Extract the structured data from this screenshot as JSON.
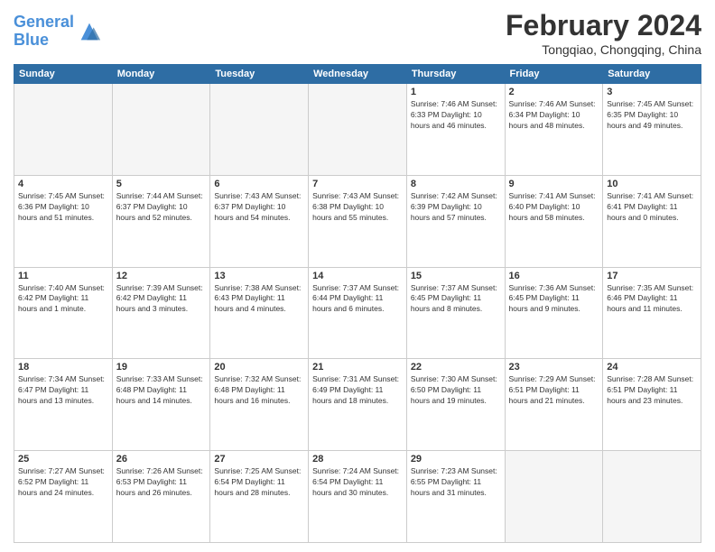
{
  "logo": {
    "line1": "General",
    "line2": "Blue"
  },
  "title": "February 2024",
  "subtitle": "Tongqiao, Chongqing, China",
  "headers": [
    "Sunday",
    "Monday",
    "Tuesday",
    "Wednesday",
    "Thursday",
    "Friday",
    "Saturday"
  ],
  "weeks": [
    [
      {
        "day": "",
        "info": ""
      },
      {
        "day": "",
        "info": ""
      },
      {
        "day": "",
        "info": ""
      },
      {
        "day": "",
        "info": ""
      },
      {
        "day": "1",
        "info": "Sunrise: 7:46 AM\nSunset: 6:33 PM\nDaylight: 10 hours\nand 46 minutes."
      },
      {
        "day": "2",
        "info": "Sunrise: 7:46 AM\nSunset: 6:34 PM\nDaylight: 10 hours\nand 48 minutes."
      },
      {
        "day": "3",
        "info": "Sunrise: 7:45 AM\nSunset: 6:35 PM\nDaylight: 10 hours\nand 49 minutes."
      }
    ],
    [
      {
        "day": "4",
        "info": "Sunrise: 7:45 AM\nSunset: 6:36 PM\nDaylight: 10 hours\nand 51 minutes."
      },
      {
        "day": "5",
        "info": "Sunrise: 7:44 AM\nSunset: 6:37 PM\nDaylight: 10 hours\nand 52 minutes."
      },
      {
        "day": "6",
        "info": "Sunrise: 7:43 AM\nSunset: 6:37 PM\nDaylight: 10 hours\nand 54 minutes."
      },
      {
        "day": "7",
        "info": "Sunrise: 7:43 AM\nSunset: 6:38 PM\nDaylight: 10 hours\nand 55 minutes."
      },
      {
        "day": "8",
        "info": "Sunrise: 7:42 AM\nSunset: 6:39 PM\nDaylight: 10 hours\nand 57 minutes."
      },
      {
        "day": "9",
        "info": "Sunrise: 7:41 AM\nSunset: 6:40 PM\nDaylight: 10 hours\nand 58 minutes."
      },
      {
        "day": "10",
        "info": "Sunrise: 7:41 AM\nSunset: 6:41 PM\nDaylight: 11 hours\nand 0 minutes."
      }
    ],
    [
      {
        "day": "11",
        "info": "Sunrise: 7:40 AM\nSunset: 6:42 PM\nDaylight: 11 hours\nand 1 minute."
      },
      {
        "day": "12",
        "info": "Sunrise: 7:39 AM\nSunset: 6:42 PM\nDaylight: 11 hours\nand 3 minutes."
      },
      {
        "day": "13",
        "info": "Sunrise: 7:38 AM\nSunset: 6:43 PM\nDaylight: 11 hours\nand 4 minutes."
      },
      {
        "day": "14",
        "info": "Sunrise: 7:37 AM\nSunset: 6:44 PM\nDaylight: 11 hours\nand 6 minutes."
      },
      {
        "day": "15",
        "info": "Sunrise: 7:37 AM\nSunset: 6:45 PM\nDaylight: 11 hours\nand 8 minutes."
      },
      {
        "day": "16",
        "info": "Sunrise: 7:36 AM\nSunset: 6:45 PM\nDaylight: 11 hours\nand 9 minutes."
      },
      {
        "day": "17",
        "info": "Sunrise: 7:35 AM\nSunset: 6:46 PM\nDaylight: 11 hours\nand 11 minutes."
      }
    ],
    [
      {
        "day": "18",
        "info": "Sunrise: 7:34 AM\nSunset: 6:47 PM\nDaylight: 11 hours\nand 13 minutes."
      },
      {
        "day": "19",
        "info": "Sunrise: 7:33 AM\nSunset: 6:48 PM\nDaylight: 11 hours\nand 14 minutes."
      },
      {
        "day": "20",
        "info": "Sunrise: 7:32 AM\nSunset: 6:48 PM\nDaylight: 11 hours\nand 16 minutes."
      },
      {
        "day": "21",
        "info": "Sunrise: 7:31 AM\nSunset: 6:49 PM\nDaylight: 11 hours\nand 18 minutes."
      },
      {
        "day": "22",
        "info": "Sunrise: 7:30 AM\nSunset: 6:50 PM\nDaylight: 11 hours\nand 19 minutes."
      },
      {
        "day": "23",
        "info": "Sunrise: 7:29 AM\nSunset: 6:51 PM\nDaylight: 11 hours\nand 21 minutes."
      },
      {
        "day": "24",
        "info": "Sunrise: 7:28 AM\nSunset: 6:51 PM\nDaylight: 11 hours\nand 23 minutes."
      }
    ],
    [
      {
        "day": "25",
        "info": "Sunrise: 7:27 AM\nSunset: 6:52 PM\nDaylight: 11 hours\nand 24 minutes."
      },
      {
        "day": "26",
        "info": "Sunrise: 7:26 AM\nSunset: 6:53 PM\nDaylight: 11 hours\nand 26 minutes."
      },
      {
        "day": "27",
        "info": "Sunrise: 7:25 AM\nSunset: 6:54 PM\nDaylight: 11 hours\nand 28 minutes."
      },
      {
        "day": "28",
        "info": "Sunrise: 7:24 AM\nSunset: 6:54 PM\nDaylight: 11 hours\nand 30 minutes."
      },
      {
        "day": "29",
        "info": "Sunrise: 7:23 AM\nSunset: 6:55 PM\nDaylight: 11 hours\nand 31 minutes."
      },
      {
        "day": "",
        "info": ""
      },
      {
        "day": "",
        "info": ""
      }
    ]
  ]
}
